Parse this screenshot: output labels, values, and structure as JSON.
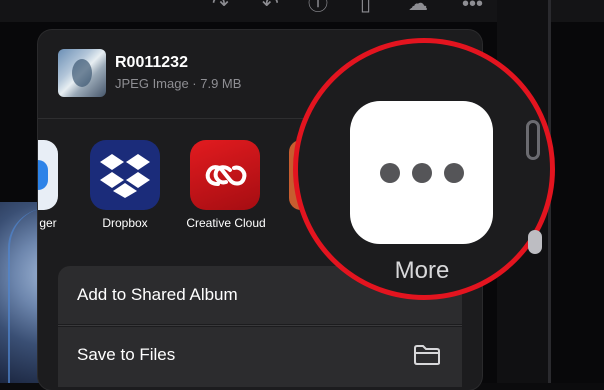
{
  "file": {
    "name": "R0011232",
    "meta": "JPEG Image · 7.9 MB"
  },
  "apps": [
    {
      "label": "ger"
    },
    {
      "label": "Dropbox"
    },
    {
      "label": "Creative Cloud"
    }
  ],
  "actions": [
    {
      "label": "Add to Shared Album"
    },
    {
      "label": "Save to Files"
    }
  ],
  "more": {
    "label": "More"
  },
  "colors": {
    "highlight_ring": "#e3141f",
    "dropbox_bg": "#1b2c7a",
    "creative_cloud_bg": "#d4151b"
  }
}
